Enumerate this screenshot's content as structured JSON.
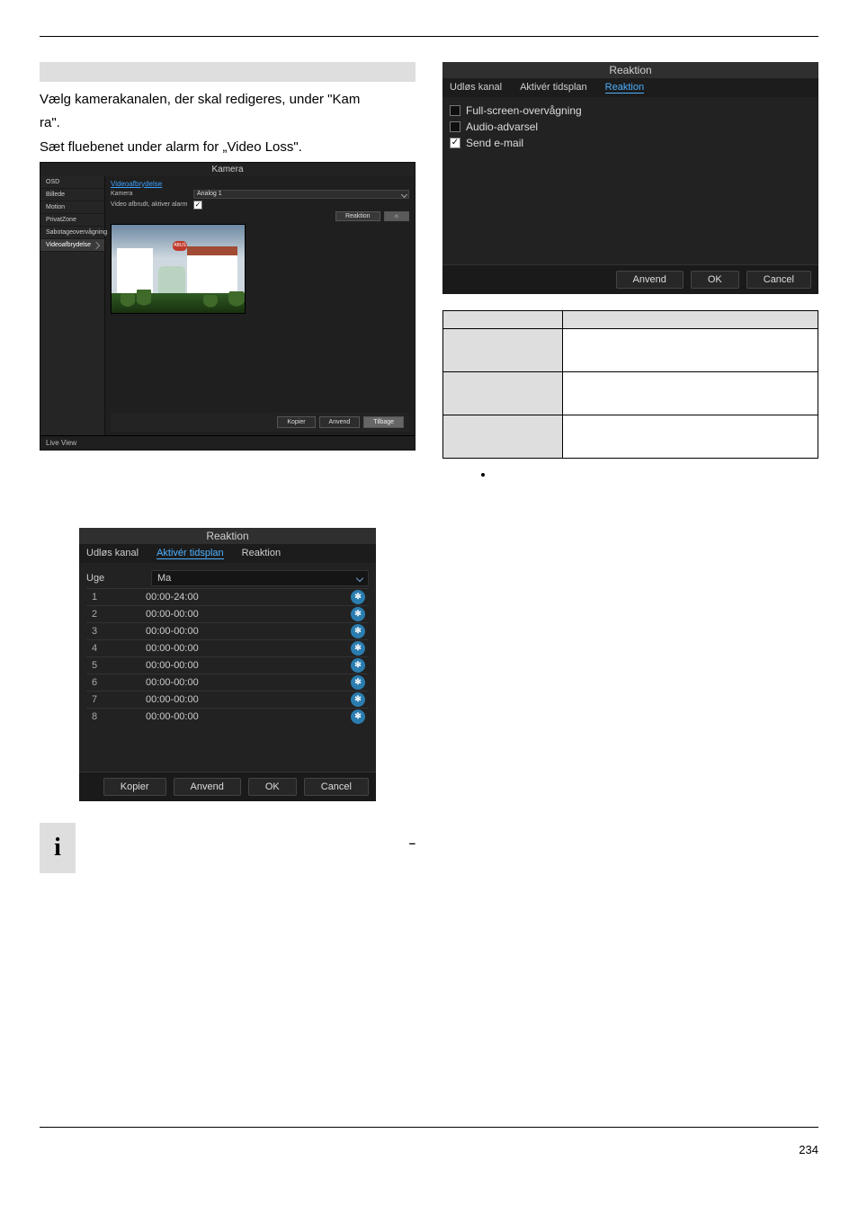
{
  "page_number": "234",
  "left_heading_placeholder": "",
  "left_paragraph_line1": "Vælg kamerakanalen, der skal redigeres, under \"Kam",
  "left_paragraph_line2": "ra\".",
  "left_paragraph_line3": "Sæt fluebenet under alarm for „Video Loss\".",
  "kamera_panel": {
    "title": "Kamera",
    "menu": [
      "OSD",
      "Billede",
      "Motion",
      "PrivatZone",
      "Sabotageovervågning",
      "Videoafbrydelse"
    ],
    "menu_selected_index": 5,
    "link": "Videoafbrydelse",
    "row1_label": "Kamera",
    "row1_value": "Analog 1",
    "row2_label": "Video afbrudt, aktiver alarm",
    "row2_checked": true,
    "action_btn": "Reaktion",
    "sign": "ABUS",
    "footer_buttons": [
      "Kopier",
      "Anvend",
      "Tilbage"
    ],
    "live": "Live View"
  },
  "schedule_panel": {
    "title": "Reaktion",
    "tabs": [
      "Udløs kanal",
      "Aktivér tidsplan",
      "Reaktion"
    ],
    "tab_selected_index": 1,
    "week_label": "Uge",
    "week_value": "Ma",
    "rows": [
      {
        "n": "1",
        "time": "00:00-24:00"
      },
      {
        "n": "2",
        "time": "00:00-00:00"
      },
      {
        "n": "3",
        "time": "00:00-00:00"
      },
      {
        "n": "4",
        "time": "00:00-00:00"
      },
      {
        "n": "5",
        "time": "00:00-00:00"
      },
      {
        "n": "6",
        "time": "00:00-00:00"
      },
      {
        "n": "7",
        "time": "00:00-00:00"
      },
      {
        "n": "8",
        "time": "00:00-00:00"
      }
    ],
    "footer": [
      "Kopier",
      "Anvend",
      "OK",
      "Cancel"
    ]
  },
  "reaction_panel": {
    "title": "Reaktion",
    "tabs": [
      "Udløs kanal",
      "Aktivér tidsplan",
      "Reaktion"
    ],
    "tab_selected_index": 2,
    "items": [
      {
        "label": "Full-screen-overvågning",
        "checked": false
      },
      {
        "label": "Audio-advarsel",
        "checked": false
      },
      {
        "label": "Send e-mail",
        "checked": true
      }
    ],
    "footer": [
      "Anvend",
      "OK",
      "Cancel"
    ]
  },
  "note": {
    "icon": "i",
    "line_fragment_suffix": "–"
  }
}
